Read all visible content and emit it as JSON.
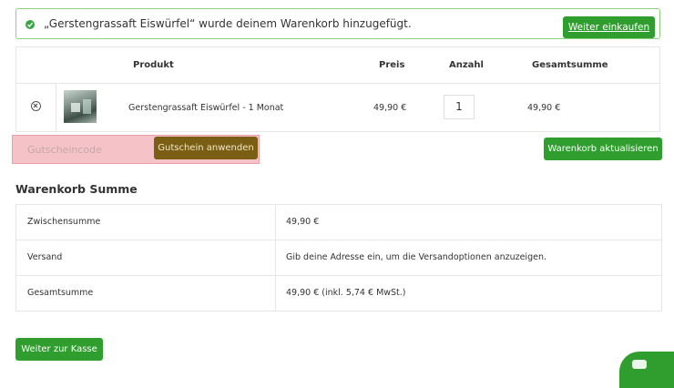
{
  "notice": {
    "message": "„Gerstengrassaft Eiswürfel“ wurde deinem Warenkorb hinzugefügt.",
    "continue_label": "Weiter einkaufen"
  },
  "cart": {
    "headers": {
      "product": "Produkt",
      "price": "Preis",
      "quantity": "Anzahl",
      "subtotal": "Gesamtsumme"
    },
    "items": [
      {
        "name": "Gerstengrassaft Eiswürfel - 1 Monat",
        "price": "49,90 €",
        "quantity": "1",
        "total": "49,90 €"
      }
    ]
  },
  "coupon": {
    "placeholder": "Gutscheincode",
    "apply_label": "Gutschein anwenden"
  },
  "update_label": "Warenkorb aktualisieren",
  "totals": {
    "title": "Warenkorb Summe",
    "rows": [
      {
        "label": "Zwischensumme",
        "value": "49,90 €"
      },
      {
        "label": "Versand",
        "value": "Gib deine Adresse ein, um die Versandoptionen anzuzeigen."
      },
      {
        "label": "Gesamtsumme",
        "value": "49,90 € (inkl. 5,74 € MwSt.)"
      }
    ]
  },
  "checkout_label": "Weiter zur Kasse",
  "colors": {
    "accent": "#2f9e2f",
    "coupon_button": "#7a5e14",
    "coupon_highlight": "#f5c3c7"
  }
}
